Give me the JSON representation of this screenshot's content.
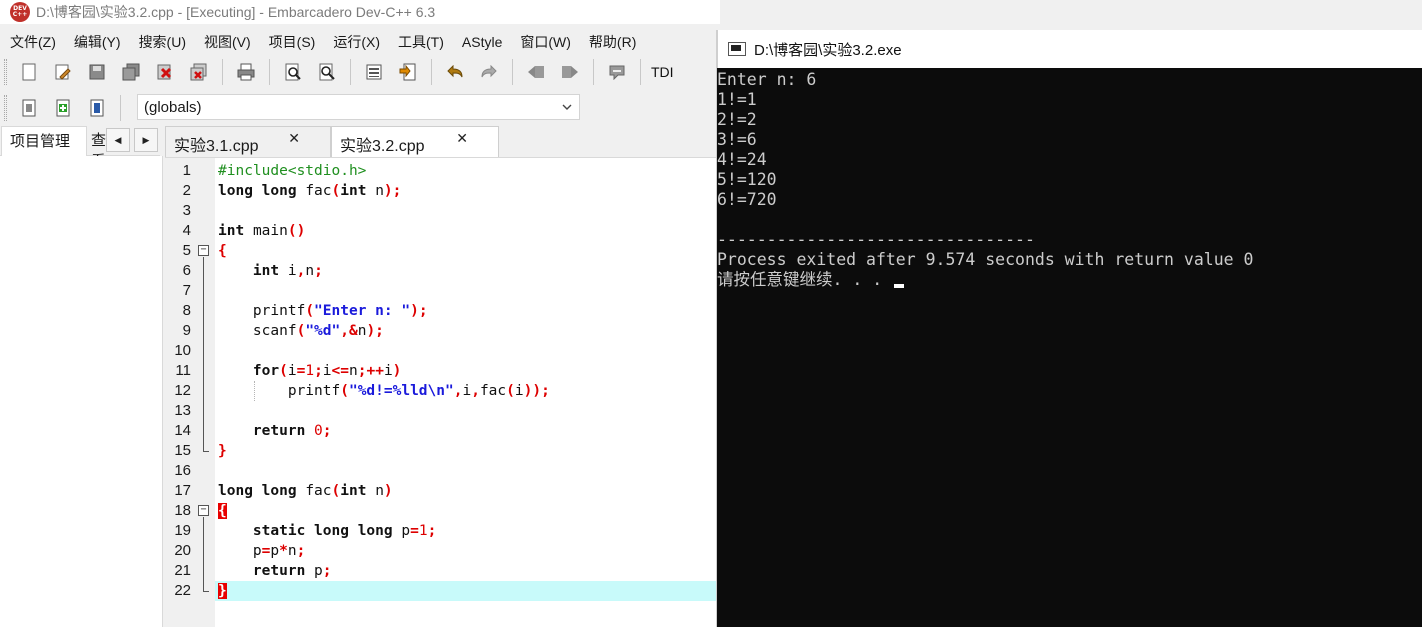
{
  "ide": {
    "title": "D:\\博客园\\实验3.2.cpp - [Executing] - Embarcadero Dev-C++ 6.3",
    "logo_text": "DEV C++",
    "menu": [
      "文件(Z)",
      "编辑(Y)",
      "搜索(U)",
      "视图(V)",
      "项目(S)",
      "运行(X)",
      "工具(T)",
      "AStyle",
      "窗口(W)",
      "帮助(R)"
    ],
    "toolbar_label": "TDI",
    "globals_select": "(globals)",
    "left_tabs": {
      "active": "项目管理",
      "inactive": "查看类"
    },
    "editor_tabs": [
      {
        "label": "实验3.1.cpp",
        "active": false
      },
      {
        "label": "实验3.2.cpp",
        "active": true
      }
    ],
    "close_glyph": "✕"
  },
  "code": {
    "line_numbers": [
      "1",
      "2",
      "3",
      "4",
      "5",
      "6",
      "7",
      "8",
      "9",
      "10",
      "11",
      "12",
      "13",
      "14",
      "15",
      "16",
      "17",
      "18",
      "19",
      "20",
      "21",
      "22"
    ],
    "active_line": 22,
    "lines": [
      "#include<stdio.h>",
      "long long fac(int n);",
      "",
      "int main()",
      "{",
      "    int i,n;",
      "",
      "    printf(\"Enter n: \");",
      "    scanf(\"%d\",&n);",
      "",
      "    for(i=1;i<=n;++i)",
      "        printf(\"%d!=%lld\\n\",i,fac(i));",
      "",
      "    return 0;",
      "}",
      "",
      "long long fac(int n)",
      "{",
      "    static long long p=1;",
      "    p=p*n;",
      "    return p;",
      "}"
    ]
  },
  "console": {
    "title": "D:\\博客园\\实验3.2.exe",
    "lines": [
      "Enter n: 6",
      "1!=1",
      "2!=2",
      "3!=6",
      "4!=24",
      "5!=120",
      "6!=720",
      "",
      "--------------------------------",
      "Process exited after 9.574 seconds with return value 0",
      "请按任意键继续. . . "
    ]
  },
  "colors": {
    "keyword": "#111111",
    "preprocessor": "#1f8f1f",
    "string": "#1a1adb",
    "operator": "#dd0000",
    "active_line_bg": "#c8fafa",
    "brace_highlight": "#e80000",
    "console_bg": "#0c0c0c",
    "console_fg": "#cccccc"
  }
}
